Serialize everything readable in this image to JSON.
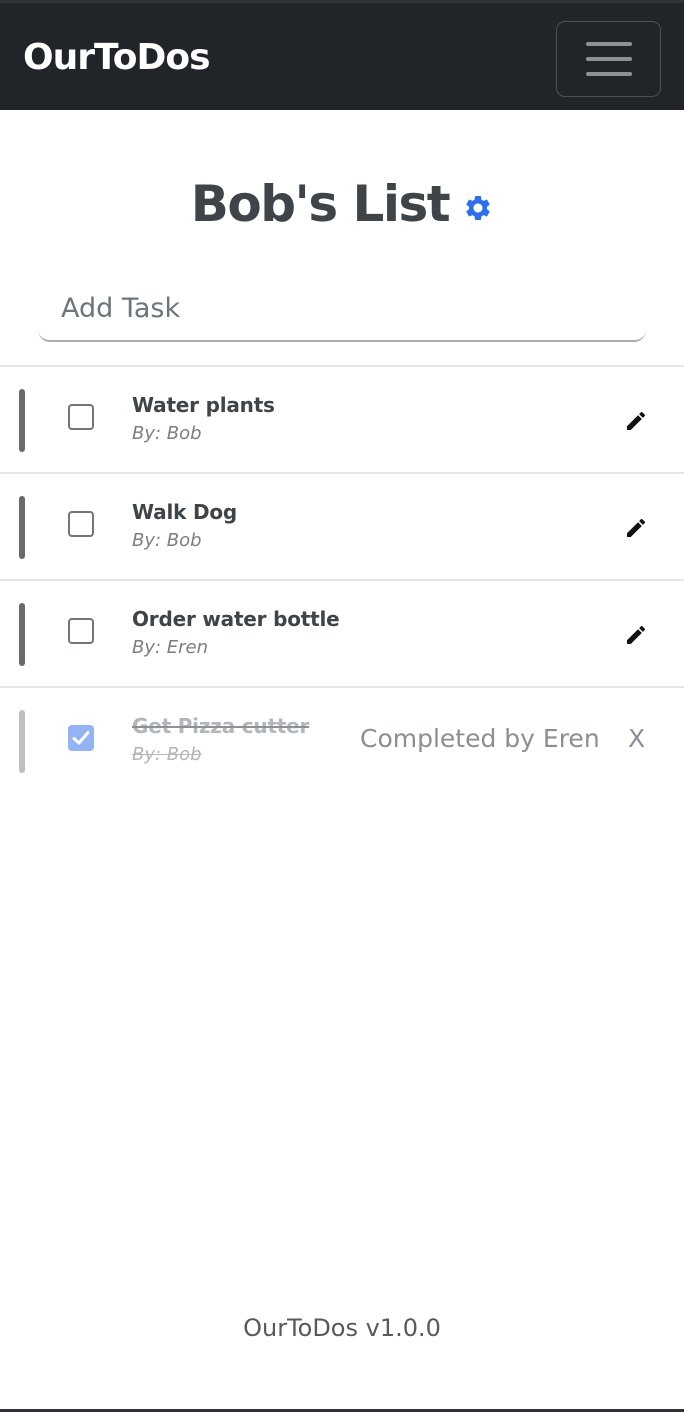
{
  "navbar": {
    "brand": "OurToDos",
    "menu_icon": "hamburger-menu-icon"
  },
  "list": {
    "title": "Bob's List",
    "settings_icon": "gear-icon",
    "accent_color": "#2f6fed"
  },
  "add_task": {
    "placeholder": "Add Task",
    "value": ""
  },
  "tasks": [
    {
      "title": "Water plants",
      "author": "By: Bob",
      "completed": false,
      "action_icon": "pencil-icon"
    },
    {
      "title": "Walk Dog",
      "author": "By: Bob",
      "completed": false,
      "action_icon": "pencil-icon"
    },
    {
      "title": "Order water bottle",
      "author": "By: Eren",
      "completed": false,
      "action_icon": "pencil-icon"
    },
    {
      "title": "Get Pizza cutter",
      "author": "By: Bob",
      "completed": true,
      "status_text": "Completed by Eren",
      "delete_label": "X"
    }
  ],
  "footer": {
    "version_text": "OurToDos v1.0.0"
  }
}
